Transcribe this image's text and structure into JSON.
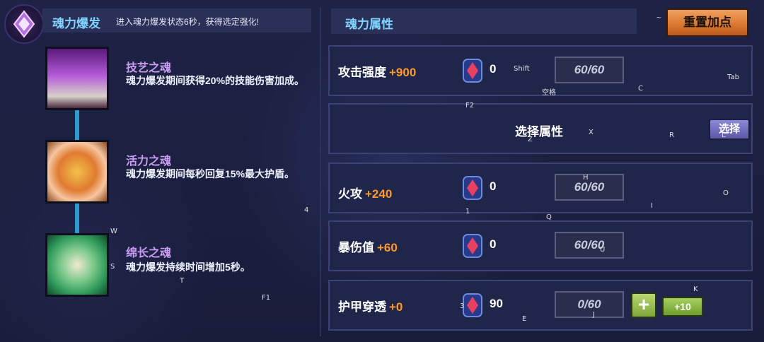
{
  "left_header": {
    "title": "魂力爆发",
    "description": "进入魂力爆发状态6秒，获得选定强化!"
  },
  "souls": [
    {
      "name": "技艺之魂",
      "description": "魂力爆发期间获得20%的技能伤害加成。"
    },
    {
      "name": "活力之魂",
      "description": "魂力爆发期间每秒回复15%最大护盾。"
    },
    {
      "name": "绵长之魂",
      "description": "魂力爆发持续时间增加5秒。"
    }
  ],
  "right_header": {
    "title": "魂力属性",
    "reset_label": "重置加点",
    "tilde": "~"
  },
  "attributes": [
    {
      "label": "攻击强度",
      "bonus": "+900",
      "gems": "0",
      "level": "60/60"
    },
    {
      "label": "火攻",
      "bonus": "+240",
      "gems": "0",
      "level": "60/60"
    },
    {
      "label": "暴伤值",
      "bonus": "+60",
      "gems": "0",
      "level": "60/60"
    },
    {
      "label": "护甲穿透",
      "bonus": "+0",
      "gems": "90",
      "level": "0/60",
      "plus_label": "+",
      "plus10_label": "+10"
    }
  ],
  "select_row": {
    "label": "选择属性",
    "button_label": "选择"
  },
  "key_hints": {
    "shift": "Shift",
    "space": "空格",
    "c": "C",
    "tab": "Tab",
    "f2": "F2",
    "x": "X",
    "z": "Z",
    "r": "R",
    "l": "L",
    "h": "H",
    "o": "O",
    "i": "I",
    "one": "1",
    "q": "Q",
    "four": "4",
    "w": "W",
    "s": "S",
    "u": "U",
    "t": "T",
    "f1": "F1",
    "k": "K",
    "three": "3",
    "e": "E",
    "j": "J"
  },
  "colors": {
    "accent_title": "#7fd4ff",
    "bonus": "#ff9a2a",
    "soul_name": "#c89cf2",
    "reset_button": "#d9762e"
  }
}
